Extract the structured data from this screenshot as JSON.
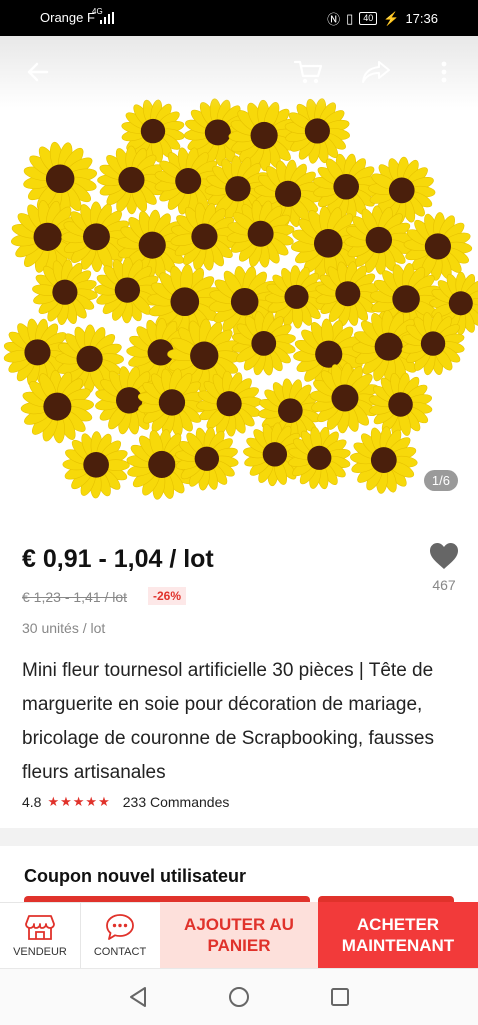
{
  "status_bar": {
    "carrier": "Orange F",
    "network": "4G",
    "battery": "40",
    "time": "17:36"
  },
  "top_bar": {
    "back_icon": "back-arrow-icon",
    "cart_icon": "cart-icon",
    "share_icon": "share-icon",
    "more_icon": "more-icon"
  },
  "gallery": {
    "counter": "1/6"
  },
  "product": {
    "price": "€ 0,91 - 1,04 / lot",
    "old_price": "€ 1,23 - 1,41 / lot",
    "discount": "-26%",
    "unit": "30 unités / lot",
    "wishlist_count": "467",
    "title": "Mini fleur tournesol artificielle 30 pièces | Tête de marguerite en soie pour décoration de mariage, bricolage de couronne de Scrapbooking, fausses fleurs artisanales",
    "rating": "4.8",
    "stars": "★★★★★",
    "orders": "233 Commandes"
  },
  "coupon": {
    "title": "Coupon nouvel utilisateur"
  },
  "bottom_bar": {
    "vendor_label": "VENDEUR",
    "contact_label": "CONTACT",
    "add_to_cart": "AJOUTER AU PANIER",
    "buy_now": "ACHETER MAINTENANT"
  },
  "colors": {
    "accent": "#e0322b",
    "buy_button": "#f23a3a",
    "add_button_bg": "#fde0db",
    "flower_petal": "#f7d90a",
    "flower_center": "#4a1f0c"
  }
}
